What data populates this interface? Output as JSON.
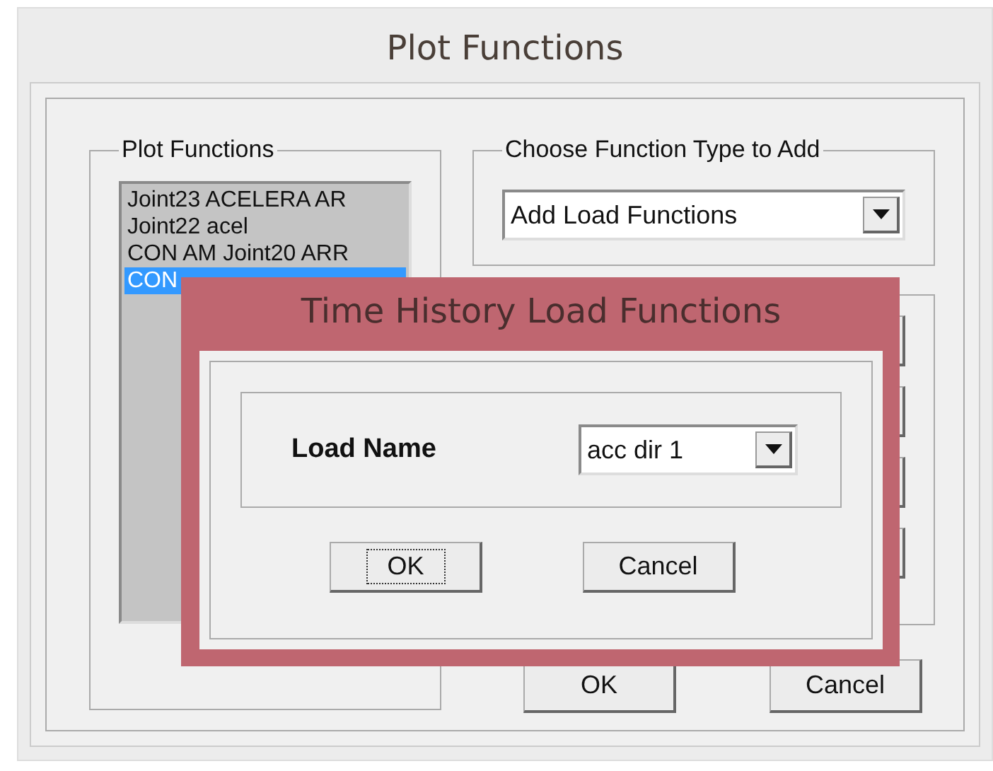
{
  "window": {
    "title": "Plot Functions"
  },
  "plot_functions": {
    "label": "Plot Functions",
    "items": [
      {
        "text": "Joint23 ACELERA AR",
        "selected": false
      },
      {
        "text": "Joint22 acel",
        "selected": false
      },
      {
        "text": "CON AM Joint20 ARR",
        "selected": false
      },
      {
        "text": "CON",
        "selected": true
      }
    ]
  },
  "function_type": {
    "label": "Choose  Function Type to Add",
    "value": "Add Load Functions"
  },
  "buttons": [
    "OK",
    "Cancel"
  ],
  "dialog": {
    "title": "Time History Load Functions",
    "field_label": "Load Name",
    "value": "acc dir 1",
    "buttons": [
      {
        "label": "OK",
        "focused": true
      },
      {
        "label": "Cancel",
        "focused": false
      }
    ]
  }
}
